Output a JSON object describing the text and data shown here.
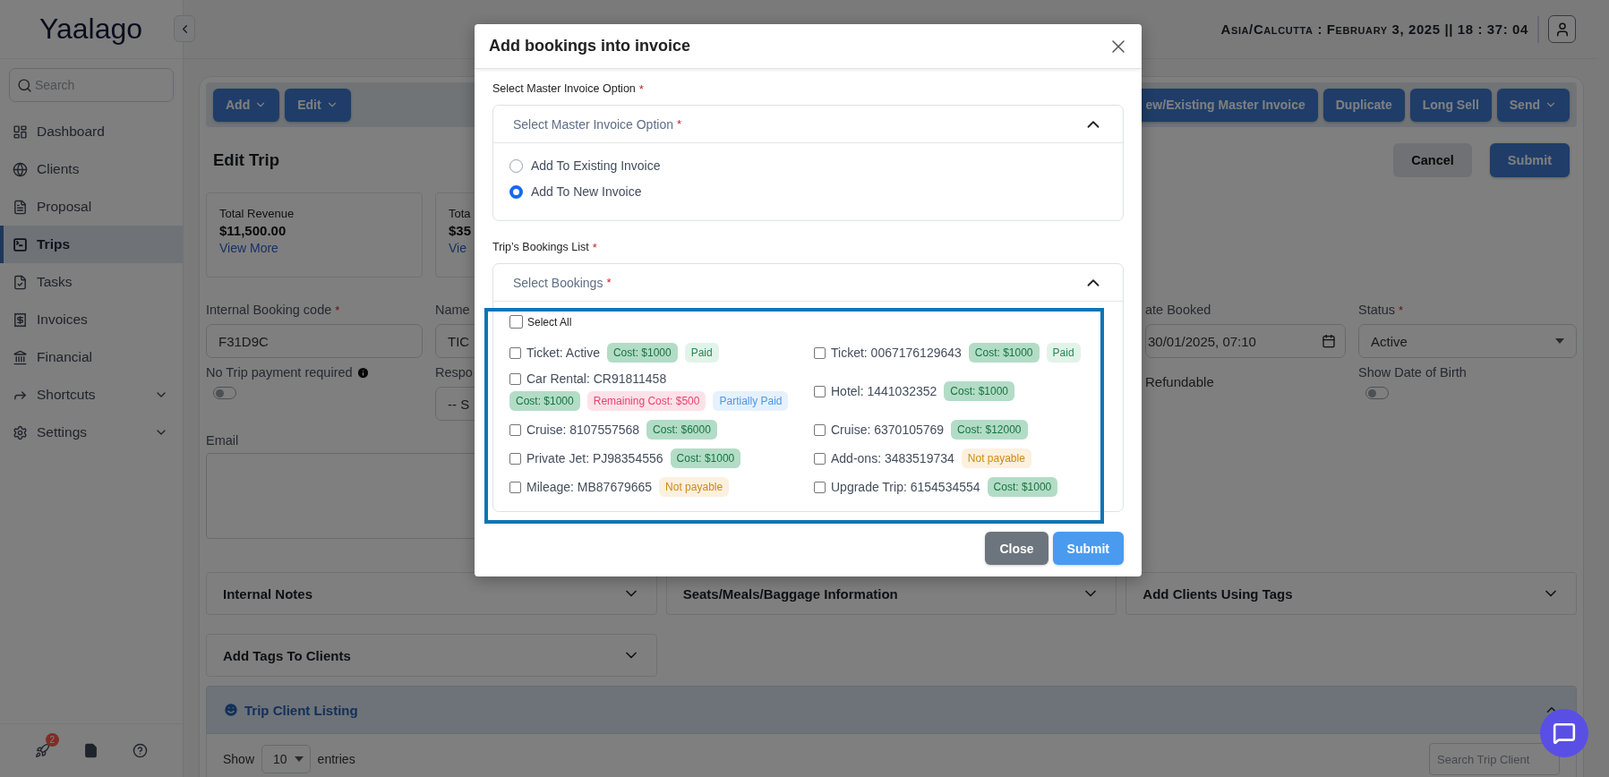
{
  "sidebar": {
    "logo": "Yaalago",
    "search": {
      "placeholder": "Search"
    },
    "items": [
      {
        "label": "Dashboard",
        "selected": false
      },
      {
        "label": "Clients",
        "selected": false
      },
      {
        "label": "Proposal",
        "selected": false
      },
      {
        "label": "Trips",
        "selected": true
      },
      {
        "label": "Tasks",
        "selected": false
      },
      {
        "label": "Invoices",
        "selected": false
      },
      {
        "label": "Financial",
        "selected": false
      },
      {
        "label": "Shortcuts",
        "selected": false,
        "expanded": false
      },
      {
        "label": "Settings",
        "selected": false,
        "expanded": false
      }
    ],
    "footer": {
      "notification_count": "2"
    }
  },
  "header": {
    "datetime": "Asia/Calcutta : February 3, 2025 || 18 : 37: 04"
  },
  "toolbar": {
    "left": [
      {
        "label": "Add",
        "menu": true
      },
      {
        "label": "Edit",
        "menu": true
      }
    ],
    "right": [
      {
        "label": "ew/Existing Master Invoice",
        "menu": false
      },
      {
        "label": "Duplicate",
        "menu": false
      },
      {
        "label": "Long Sell",
        "menu": false
      },
      {
        "label": "Send",
        "menu": true
      }
    ]
  },
  "page": {
    "title": "Edit Trip",
    "actions": [
      {
        "label": "Cancel",
        "kind": "secondary"
      },
      {
        "label": "Submit",
        "kind": "primary"
      }
    ]
  },
  "summary_cards": [
    {
      "label": "Total Revenue",
      "value": "$11,500.00",
      "link": "View More"
    },
    {
      "label": "Tota",
      "value": "$35",
      "link": "Vie"
    }
  ],
  "fields": [
    [
      {
        "kind": "input",
        "label": "Internal Booking code",
        "mark": "*",
        "value": "F31D9C"
      },
      {
        "kind": "toggle",
        "label": "No Trip payment required",
        "info": true,
        "on": false
      }
    ],
    [
      {
        "kind": "input",
        "label": "Name",
        "value": "TIC"
      },
      {
        "kind": "select",
        "label": "Respo",
        "value": "-- S"
      }
    ],
    [
      {
        "kind": "date",
        "label": "ate Booked",
        "value": "30/01/2025, 07:10"
      },
      {
        "kind": "check",
        "label": "Refundable"
      }
    ],
    [
      {
        "kind": "select",
        "label": "Status",
        "mark": "*",
        "value": "Active",
        "caret": true
      },
      {
        "kind": "toggle",
        "label": "Show Date of Birth",
        "on": false
      }
    ]
  ],
  "email": {
    "label": "Email"
  },
  "accordions": [
    {
      "title": "Internal Notes",
      "expanded": false
    },
    {
      "title": "Seats/Meals/Baggage Information",
      "expanded": false
    },
    {
      "title": "Add Clients Using Tags",
      "expanded": false
    },
    {
      "title": "Add Tags To Clients",
      "expanded": false
    }
  ],
  "client_listing": {
    "title": "Trip Client Listing",
    "expanded": true,
    "show_label": "Show",
    "page_size": "10",
    "entries_label": "entries",
    "search_placeholder": "Search Trip Client"
  },
  "modal": {
    "title": "Add bookings into invoice",
    "master": {
      "label": "Select Master Invoice Option",
      "mark": "*",
      "placeholder": "Select Master Invoice Option",
      "placeholder_mark": "*",
      "expanded": true,
      "options": [
        {
          "label": "Add To Existing Invoice",
          "selected": false
        },
        {
          "label": "Add To New Invoice",
          "selected": true
        }
      ]
    },
    "bookings": {
      "label": "Trip’s Bookings List",
      "mark": "*",
      "placeholder": "Select Bookings",
      "placeholder_mark": "*",
      "expanded": true,
      "select_all": {
        "label": "Select All",
        "checked": false
      },
      "annotation": {
        "kind": "frame"
      },
      "items": [
        {
          "label": "Ticket: Active",
          "checked": false,
          "tags": [
            {
              "text": "Cost: $1000",
              "kind": "cost"
            },
            {
              "text": "Paid",
              "kind": "paid"
            }
          ]
        },
        {
          "label": "Ticket: 0067176129643",
          "checked": false,
          "tags": [
            {
              "text": "Cost: $1000",
              "kind": "cost"
            },
            {
              "text": "Paid",
              "kind": "paid"
            }
          ]
        },
        {
          "label": "Car Rental: CR91811458",
          "checked": false,
          "tags": [
            {
              "text": "Cost: $1000",
              "kind": "cost"
            },
            {
              "text": "Remaining Cost: $500",
              "kind": "remaining"
            },
            {
              "text": "Partially Paid",
              "kind": "partial"
            }
          ]
        },
        {
          "label": "Hotel: 1441032352",
          "checked": false,
          "tags": [
            {
              "text": "Cost: $1000",
              "kind": "cost"
            }
          ]
        },
        {
          "label": "Cruise: 8107557568",
          "checked": false,
          "tags": [
            {
              "text": "Cost: $6000",
              "kind": "cost"
            }
          ]
        },
        {
          "label": "Cruise: 6370105769",
          "checked": false,
          "tags": [
            {
              "text": "Cost: $12000",
              "kind": "cost"
            }
          ]
        },
        {
          "label": "Private Jet: PJ98354556",
          "checked": false,
          "tags": [
            {
              "text": "Cost: $1000",
              "kind": "cost"
            }
          ]
        },
        {
          "label": "Add-ons: 3483519734",
          "checked": false,
          "tags": [
            {
              "text": "Not payable",
              "kind": "not_payable"
            }
          ]
        },
        {
          "label": "Mileage: MB87679665",
          "checked": false,
          "tags": [
            {
              "text": "Not payable",
              "kind": "not_payable"
            }
          ]
        },
        {
          "label": "Upgrade Trip: 6154534554",
          "checked": false,
          "tags": [
            {
              "text": "Cost: $1000",
              "kind": "cost"
            }
          ]
        }
      ]
    },
    "buttons": [
      {
        "label": "Close",
        "kind": "secondary"
      },
      {
        "label": "Submit",
        "kind": "primary"
      }
    ]
  }
}
